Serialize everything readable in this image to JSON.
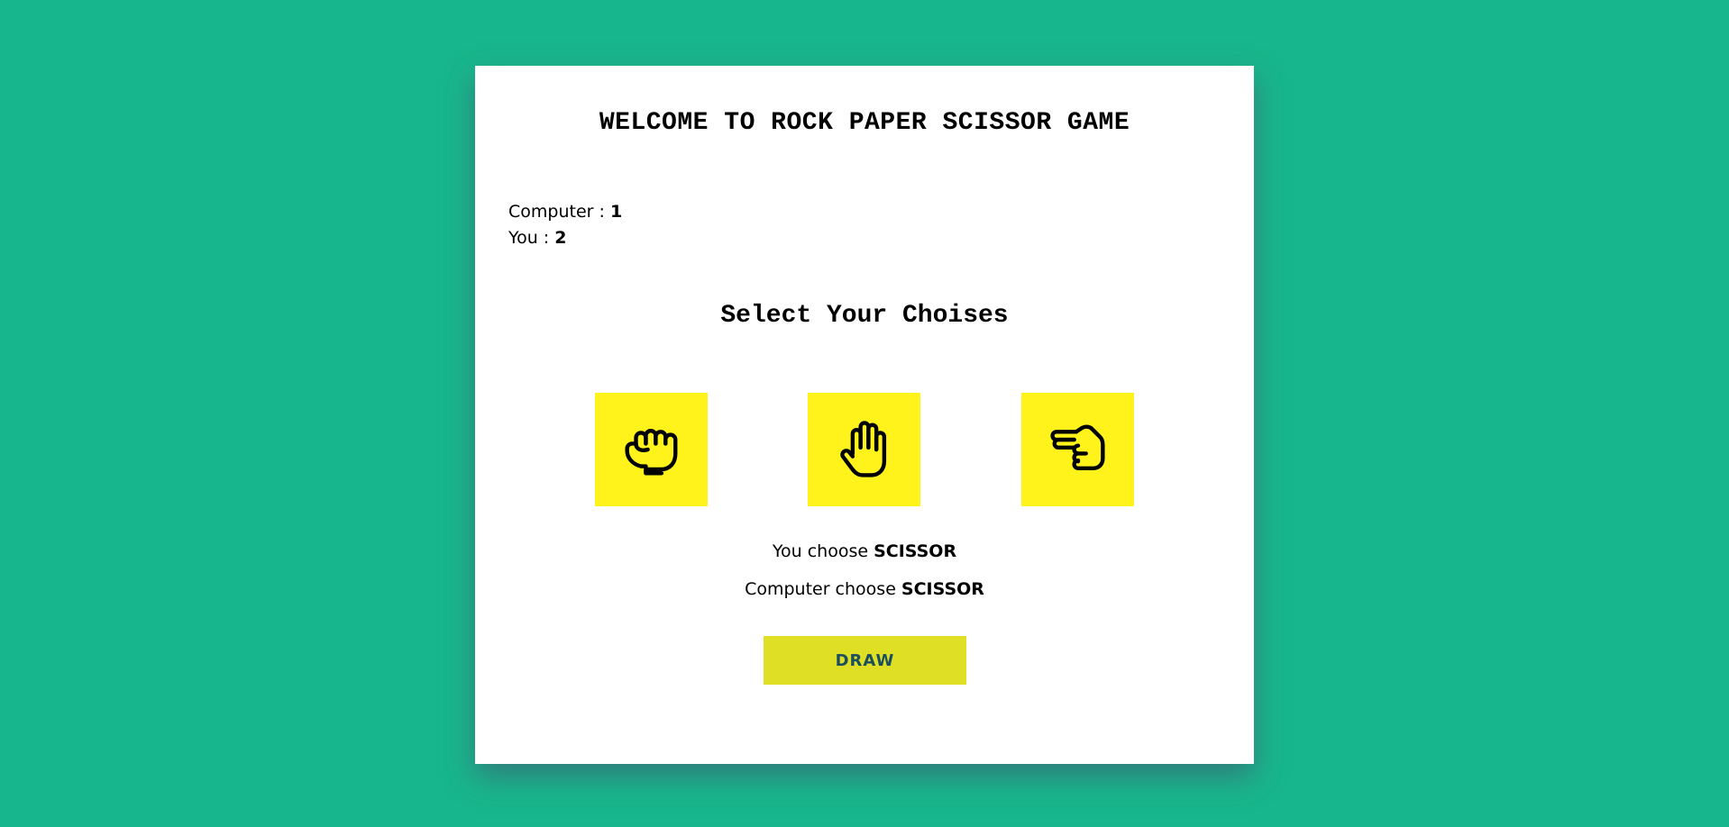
{
  "header": {
    "title": "WELCOME TO ROCK PAPER SCISSOR GAME"
  },
  "scoreboard": {
    "computer_label": "Computer : ",
    "computer_score": "1",
    "you_label": "You : ",
    "you_score": "2"
  },
  "choices": {
    "heading": "Select Your Choises",
    "items": [
      {
        "id": "rock",
        "icon": "fist-icon"
      },
      {
        "id": "paper",
        "icon": "open-hand-icon"
      },
      {
        "id": "scissor",
        "icon": "scissor-hand-icon"
      }
    ]
  },
  "result": {
    "you_prefix": "You choose ",
    "you_choice": "SCISSOR",
    "computer_prefix": "Computer choose ",
    "computer_choice": "SCISSOR"
  },
  "outcome": {
    "label": "DRAW"
  },
  "colors": {
    "background": "#18b68c",
    "card": "#ffffff",
    "choice_tile": "#fff31b",
    "outcome_button": "#dfe026",
    "outcome_text": "#1c4f5d"
  }
}
